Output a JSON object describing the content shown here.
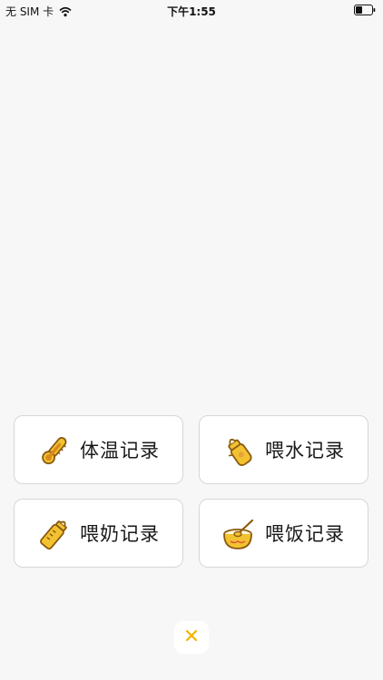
{
  "status_bar": {
    "carrier": "无 SIM 卡",
    "time": "下午1:55",
    "icons": [
      "wifi-icon",
      "battery-icon"
    ]
  },
  "cards": [
    {
      "label": "体温记录",
      "icon": "thermometer-icon"
    },
    {
      "label": "喂水记录",
      "icon": "water-bottle-icon"
    },
    {
      "label": "喂奶记录",
      "icon": "milk-bottle-icon"
    },
    {
      "label": "喂饭记录",
      "icon": "food-bowl-icon"
    }
  ],
  "close_button": {
    "icon": "close-icon"
  },
  "colors": {
    "background": "#f7f7f7",
    "card_border": "#d6d6d6",
    "accent": "#f2c230",
    "icon_outline": "#8a5a10"
  }
}
